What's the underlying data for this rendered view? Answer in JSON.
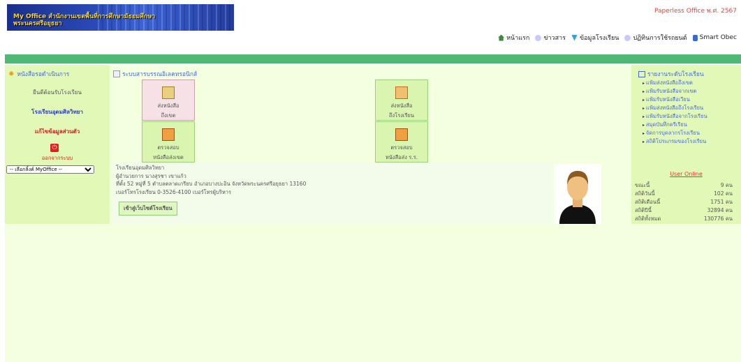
{
  "header": {
    "banner_line1": "My Office สำนักงานเขตพื้นที่การศึกษามัธยมศึกษา",
    "banner_line2": "พระนครศรีอยุธยา",
    "paperless": "Paperless Office พ.ศ. 2567"
  },
  "topnav": [
    {
      "label": "หน้าแรก",
      "icon": "home-icon"
    },
    {
      "label": "ข่าวสาร",
      "icon": "news-icon"
    },
    {
      "label": "ข้อมูลโรงเรียน",
      "icon": "school-icon"
    },
    {
      "label": "ปฏิทินการใช้รถยนต์",
      "icon": "calendar-icon"
    },
    {
      "label": "Smart Obec",
      "icon": "document-icon"
    }
  ],
  "left": {
    "title": "หนังสือรอดำเนินการ",
    "confirm": "ยืนดีต้อนรับโรงเรียน",
    "school": "โรงเรียนอุดมศิลวิทยา",
    "edit": "แก้ไขข้อมูลส่วนตัว",
    "logout": "ออกจากระบบ",
    "select": "-- เลือกลิ้งค์ MyOffice --"
  },
  "mid": {
    "title": "ระบบสารบรรณอิเลคทรอนิกส์",
    "cards": [
      {
        "l1": "ส่งหนังสือ",
        "l2": "ถึงเขต"
      },
      {
        "l1": "ส่งหนังสือ",
        "l2": "ถึงโรงเรียน"
      },
      {
        "l1": "ตรวจสอบ",
        "l2": "หนังสือส่งเขต"
      },
      {
        "l1": "ตรวจสอบ",
        "l2": "หนังสือส่ง ร.ร."
      }
    ],
    "info": [
      "โรงเรียนอุดมศิลวิทยา",
      "ผู้อำนวยการ  นางสุรชา เขาแก้ว",
      "ที่ตั้ง  52 หมู่ที่ 5 ตำบลตลาดเกรียบ อำเภอบางปะอิน จังหวัดพระนครศรีอยุธยา 13160",
      "เบอร์โทรโรงเรียน  0-3526-4100   เบอร์โทรผู้บริหาร"
    ],
    "web_button": "เข้าสู่เว็บไซต์โรงเรียน"
  },
  "right": {
    "title": "รายงานระดับโรงเรียน",
    "items": [
      "แฟ้มส่งหนังสือถึงเขต",
      "แฟ้มรับหนังสือจากเขต",
      "แฟ้มรับหนังสือเวียน",
      "แฟ้มส่งหนังสือถึงโรงเรียน",
      "แฟ้มรับหนังสือจากโรงเรียน",
      "สมุดบันทึกครีเรียน",
      "จัดการบุคลากรโรงเรียน",
      "สถิติโปรแกรมของโรงเรียน"
    ],
    "user_online": "User Online",
    "stats": [
      {
        "label": "ขณะนี้",
        "value": "9 คน"
      },
      {
        "label": "สถิติวันนี้",
        "value": "102 คน"
      },
      {
        "label": "สถิติเดือนนี้",
        "value": "1751 คน"
      },
      {
        "label": "สถิติปีนี้",
        "value": "32894 คน"
      },
      {
        "label": "สถิติทั้งหมด",
        "value": "130776 คน"
      }
    ]
  }
}
